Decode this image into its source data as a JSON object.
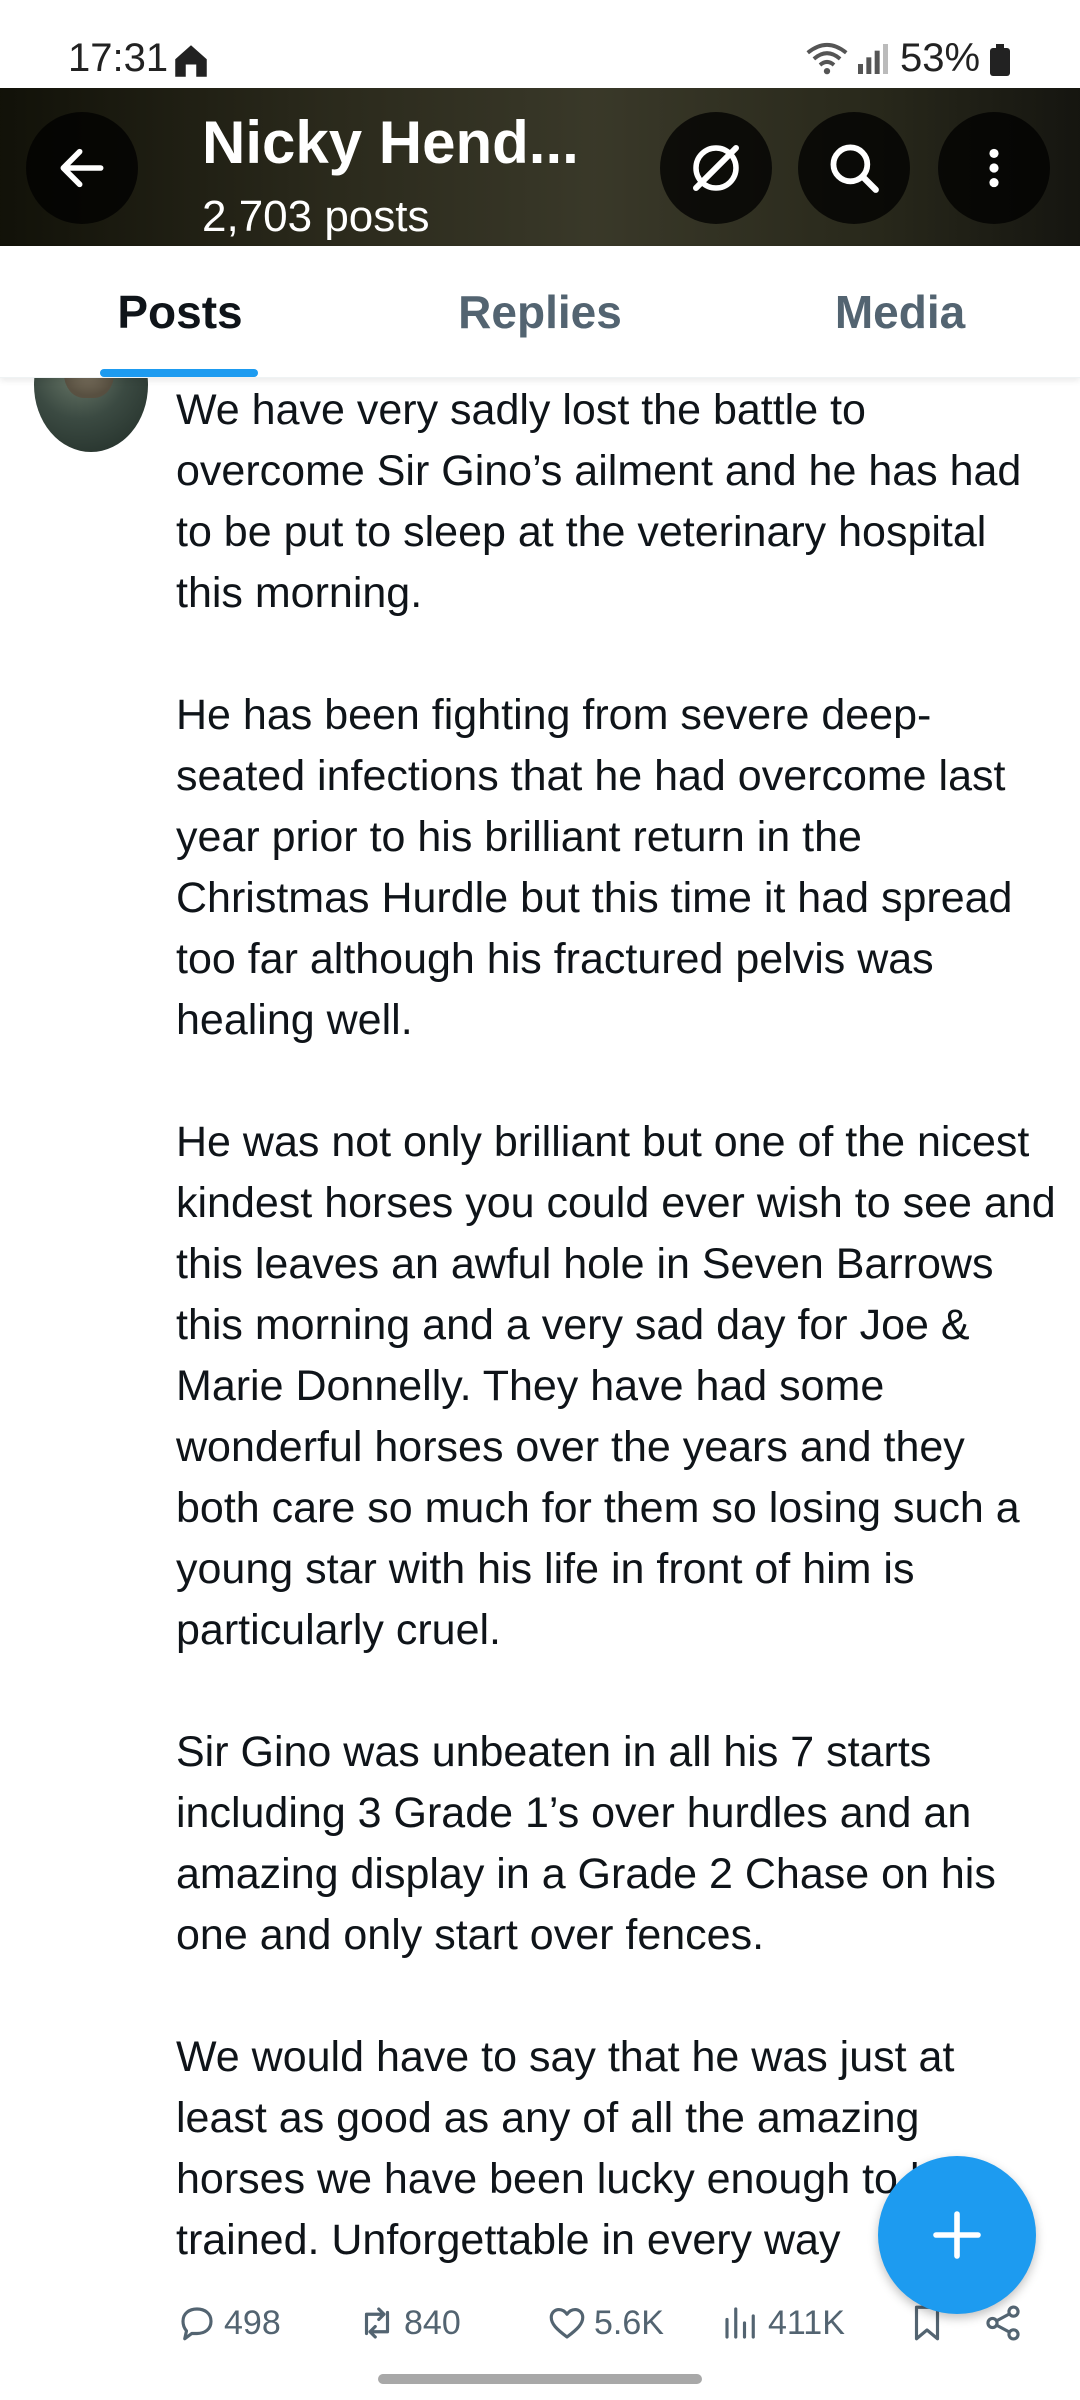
{
  "status_bar": {
    "time": "17:31",
    "battery": "53%"
  },
  "header": {
    "title": "Nicky Hend...",
    "subtitle": "2,703 posts"
  },
  "tabs": [
    {
      "label": "Posts",
      "active": true
    },
    {
      "label": "Replies",
      "active": false
    },
    {
      "label": "Media",
      "active": false
    }
  ],
  "post": {
    "paragraphs": [
      "We have very sadly lost the battle to overcome Sir Gino’s ailment and he has had to be put to sleep at the veterinary hospital this morning.",
      "He has been fighting from severe deep-seated infections that he had overcome last year prior to his brilliant return in the Christmas Hurdle but this time it had spread too far although his fractured pelvis was healing well.",
      "He was not only brilliant but one of the nicest kindest horses you could ever wish to see and this leaves an awful hole in Seven Barrows this morning and a very sad day for Joe & Marie Donnelly. They have had some wonderful horses over the years and they both care so much for them so losing such a young star with his life in front of him is particularly cruel.",
      "Sir Gino was unbeaten in all his 7 starts including 3 Grade 1’s over hurdles and an amazing display in a Grade 2 Chase on his one and only start over fences.",
      "We would have to say that he was just at least as good as any of all the amazing horses we have been lucky enough to have trained. Unforgettable in every way"
    ],
    "stats": {
      "replies": "498",
      "reposts": "840",
      "likes": "5.6K",
      "views": "411K"
    }
  },
  "colors": {
    "accent": "#1d9bf0",
    "text_primary": "#0f1419",
    "text_secondary": "#536471"
  },
  "icons": {
    "back": "arrow-left-icon",
    "grok": "grok-icon",
    "search": "search-icon",
    "more": "more-vertical-icon",
    "compose": "plus-icon"
  }
}
